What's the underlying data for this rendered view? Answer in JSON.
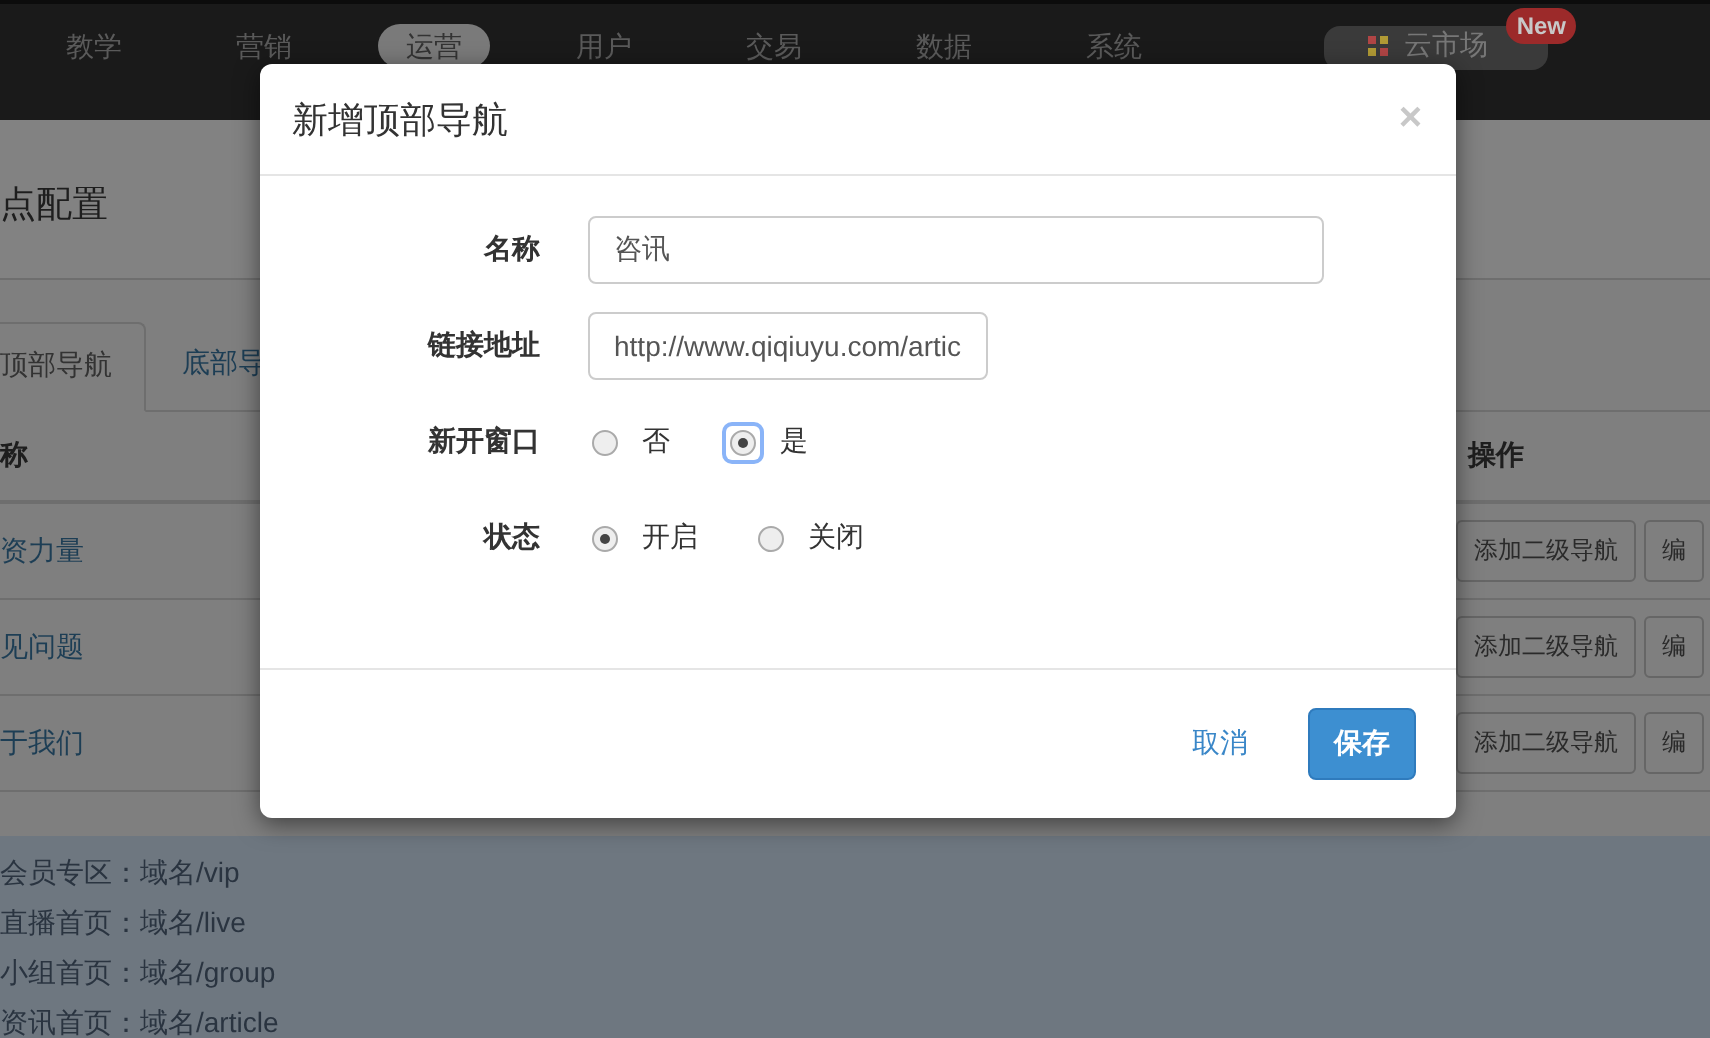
{
  "top_nav": {
    "items": [
      {
        "label": "教学",
        "selected": false
      },
      {
        "label": "营销",
        "selected": false
      },
      {
        "label": "运营",
        "selected": true
      },
      {
        "label": "用户",
        "selected": false
      },
      {
        "label": "交易",
        "selected": false
      },
      {
        "label": "数据",
        "selected": false
      },
      {
        "label": "系统",
        "selected": false
      }
    ],
    "market": {
      "label": "云市场",
      "badge": "New"
    }
  },
  "page": {
    "title": "点配置",
    "tabs": [
      {
        "label": "顶部导航",
        "selected": true
      },
      {
        "label": "底部导",
        "selected": false
      }
    ],
    "table": {
      "columns": [
        "称",
        "操作"
      ],
      "rows": [
        {
          "name": "资力量",
          "actions": [
            "添加二级导航",
            "编"
          ]
        },
        {
          "name": "见问题",
          "actions": [
            "添加二级导航",
            "编"
          ]
        },
        {
          "name": "于我们",
          "actions": [
            "添加二级导航",
            "编"
          ]
        }
      ]
    },
    "notes": [
      "会员专区：域名/vip",
      "直播首页：域名/live",
      "小组首页：域名/group",
      "资讯首页：域名/article"
    ]
  },
  "dialog": {
    "title": "新增顶部导航",
    "close": "×",
    "fields": [
      {
        "kind": "text",
        "label": "名称",
        "value": "咨讯",
        "wide": true
      },
      {
        "kind": "text",
        "label": "链接地址",
        "value": "http://www.qiqiuyu.com/artic",
        "wide": false
      },
      {
        "kind": "radio",
        "label": "新开窗口",
        "options": [
          {
            "label": "否",
            "selected": false,
            "focused": false
          },
          {
            "label": "是",
            "selected": true,
            "focused": true
          }
        ]
      },
      {
        "kind": "radio",
        "label": "状态",
        "options": [
          {
            "label": "开启",
            "selected": true,
            "focused": false
          },
          {
            "label": "关闭",
            "selected": false,
            "focused": false
          }
        ]
      }
    ],
    "buttons": [
      {
        "kind": "link",
        "label": "取消"
      },
      {
        "kind": "primary",
        "label": "保存"
      }
    ]
  }
}
